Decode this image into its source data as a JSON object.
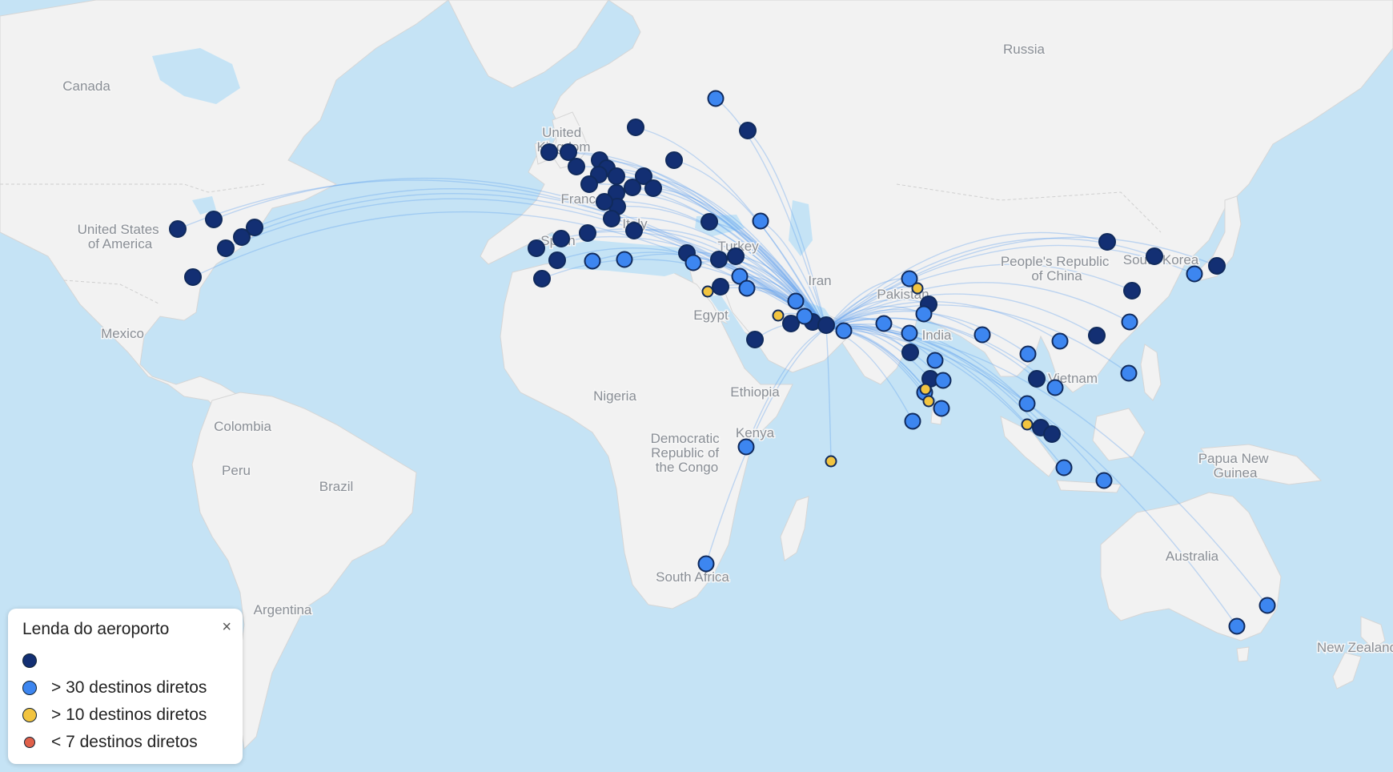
{
  "legend": {
    "title": "Lenda do aeroporto",
    "close_icon": "close-icon",
    "items": [
      {
        "label": "",
        "color": "#132f73",
        "class": "hub"
      },
      {
        "label": "> 30 destinos diretos",
        "color": "#3d86f0",
        "class": "large"
      },
      {
        "label": "> 10 destinos diretos",
        "color": "#f2c440",
        "class": "medium"
      },
      {
        "label": "< 7 destinos diretos",
        "color": "#e0604a",
        "class": "small"
      }
    ]
  },
  "map_labels": [
    {
      "id": "canada",
      "text": "Canada"
    },
    {
      "id": "usa",
      "text": "United States of America"
    },
    {
      "id": "mexico",
      "text": "Mexico"
    },
    {
      "id": "colombia",
      "text": "Colombia"
    },
    {
      "id": "peru",
      "text": "Peru"
    },
    {
      "id": "brazil",
      "text": "Brazil"
    },
    {
      "id": "argentina",
      "text": "Argentina"
    },
    {
      "id": "uk",
      "text": "United Kingdom"
    },
    {
      "id": "france",
      "text": "France"
    },
    {
      "id": "spain",
      "text": "Spain"
    },
    {
      "id": "italy",
      "text": "Italy"
    },
    {
      "id": "turkey",
      "text": "Turkey"
    },
    {
      "id": "iran",
      "text": "Iran"
    },
    {
      "id": "egypt",
      "text": "Egypt"
    },
    {
      "id": "nigeria",
      "text": "Nigeria"
    },
    {
      "id": "ethiopia",
      "text": "Ethiopia"
    },
    {
      "id": "kenya",
      "text": "Kenya"
    },
    {
      "id": "drc",
      "text": "Democratic Republic of the Congo"
    },
    {
      "id": "south_africa",
      "text": "South Africa"
    },
    {
      "id": "russia",
      "text": "Russia"
    },
    {
      "id": "pakistan",
      "text": "Pakistan"
    },
    {
      "id": "india",
      "text": "India"
    },
    {
      "id": "china",
      "text": "People's Republic of China"
    },
    {
      "id": "south_korea",
      "text": "South Korea"
    },
    {
      "id": "vietnam",
      "text": "Vietnam"
    },
    {
      "id": "png",
      "text": "Papua New Guinea"
    },
    {
      "id": "australia",
      "text": "Australia"
    },
    {
      "id": "nz",
      "text": "New Zealand"
    }
  ],
  "airport_counts": {
    "hub": 50,
    "large": 40,
    "medium": 6
  }
}
